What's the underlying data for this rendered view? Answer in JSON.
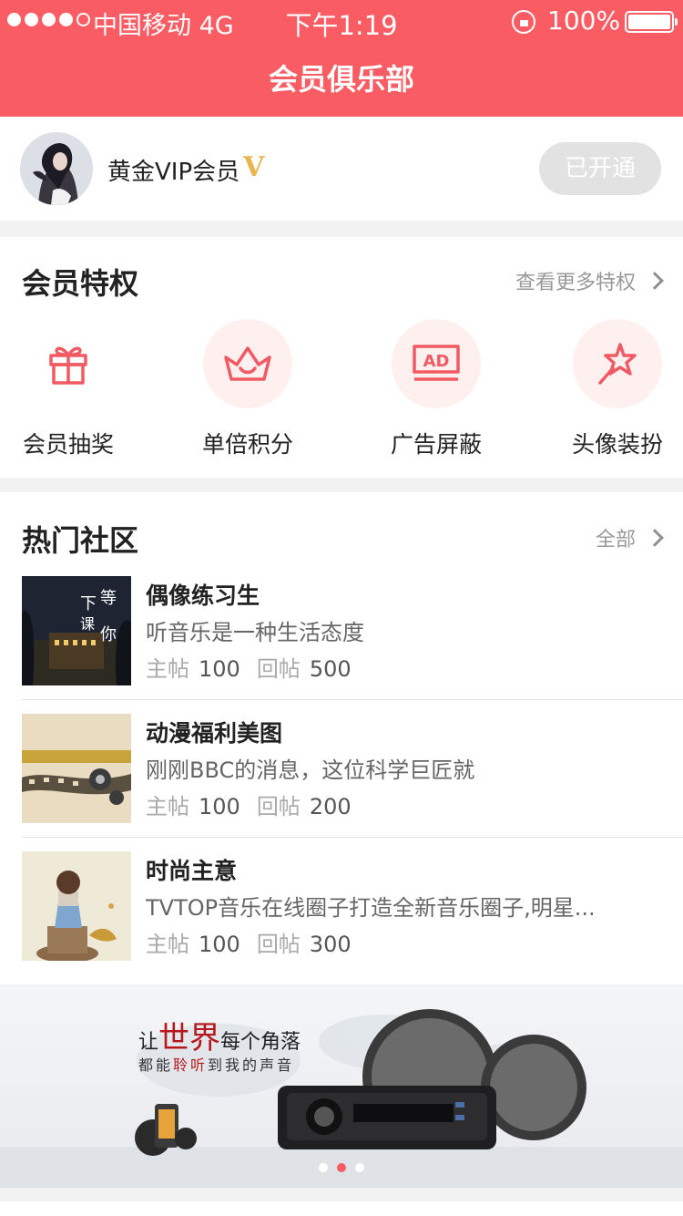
{
  "status_bar": {
    "carrier": "中国移动 4G",
    "time": "下午1:19",
    "battery": "100%"
  },
  "header": {
    "title": "会员俱乐部"
  },
  "member": {
    "name": "黄金VIP会员",
    "badge": "V",
    "button": "已开通"
  },
  "privileges": {
    "title": "会员特权",
    "more": "查看更多特权",
    "items": [
      {
        "label": "会员抽奖",
        "icon": "gift-icon"
      },
      {
        "label": "单倍积分",
        "icon": "crown-icon"
      },
      {
        "label": "广告屏蔽",
        "icon": "ad-block-icon"
      },
      {
        "label": "头像装扮",
        "icon": "magic-wand-icon"
      }
    ]
  },
  "community": {
    "title": "热门社区",
    "more": "全部",
    "stat_labels": {
      "posts": "主帖",
      "replies": "回帖"
    },
    "posts": [
      {
        "title": "偶像练习生",
        "desc": "听音乐是一种生活态度",
        "posts": "100",
        "replies": "500"
      },
      {
        "title": "动漫福利美图",
        "desc": "刚刚BBC的消息，这位科学巨匠就",
        "posts": "100",
        "replies": "200"
      },
      {
        "title": "时尚主意",
        "desc": "TVTOP音乐在线圈子打造全新音乐圈子,明星...",
        "posts": "100",
        "replies": "300"
      }
    ]
  },
  "banner": {
    "line1_a": "让",
    "line1_big": "世界",
    "line1_b": "每个角落",
    "line2_a": "都能",
    "line2_hl": "聆听",
    "line2_b": "到我的声音"
  },
  "colors": {
    "accent": "#f95c63",
    "vip_gold": "#e7b44f"
  }
}
